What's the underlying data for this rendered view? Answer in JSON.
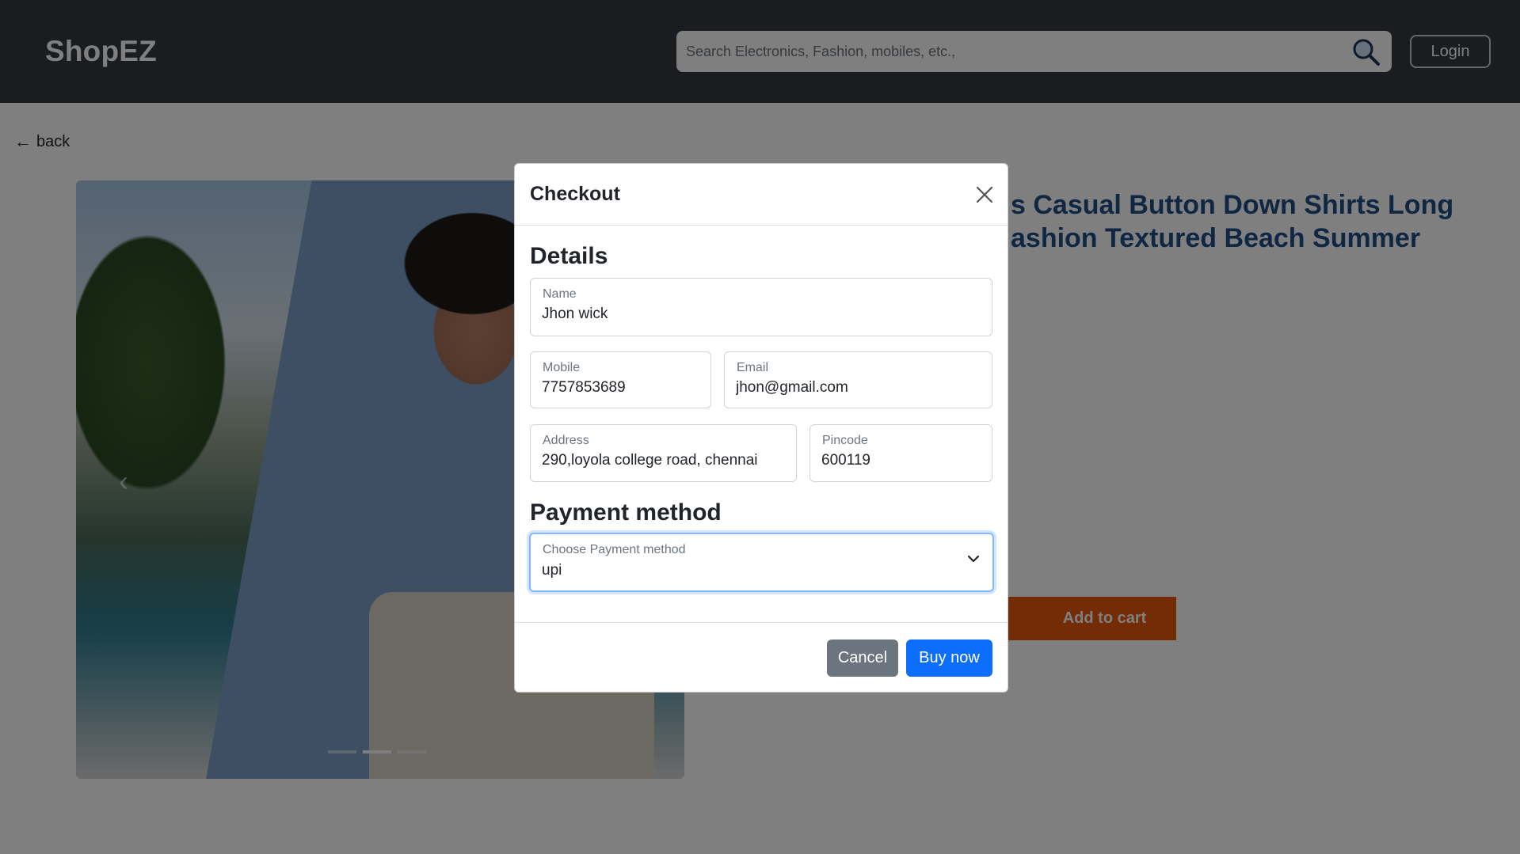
{
  "navbar": {
    "brand": "ShopEZ",
    "search_placeholder": "Search Electronics, Fashion, mobiles, etc.,",
    "login_label": "Login"
  },
  "page": {
    "back_label": "back",
    "product_title_line1": "s Casual Button Down Shirts Long",
    "product_title_line2": "ashion Textured Beach Summer",
    "add_to_cart_label": "Add to cart",
    "carousel_slides": 3,
    "carousel_active_index": 1
  },
  "modal": {
    "title": "Checkout",
    "details_heading": "Details",
    "fields": {
      "name": {
        "label": "Name",
        "value": "Jhon wick"
      },
      "mobile": {
        "label": "Mobile",
        "value": "7757853689"
      },
      "email": {
        "label": "Email",
        "value": "jhon@gmail.com"
      },
      "address": {
        "label": "Address",
        "value": "290,loyola college road, chennai"
      },
      "pincode": {
        "label": "Pincode",
        "value": "600119"
      }
    },
    "payment_heading": "Payment method",
    "payment": {
      "label": "Choose Payment method",
      "value": "upi"
    },
    "cancel_label": "Cancel",
    "buy_label": "Buy now"
  },
  "colors": {
    "navbar_bg": "#343a40",
    "primary": "#0d6efd",
    "secondary": "#6c757d",
    "cart_button": "#e8590c",
    "title_color": "#1f4e86"
  }
}
